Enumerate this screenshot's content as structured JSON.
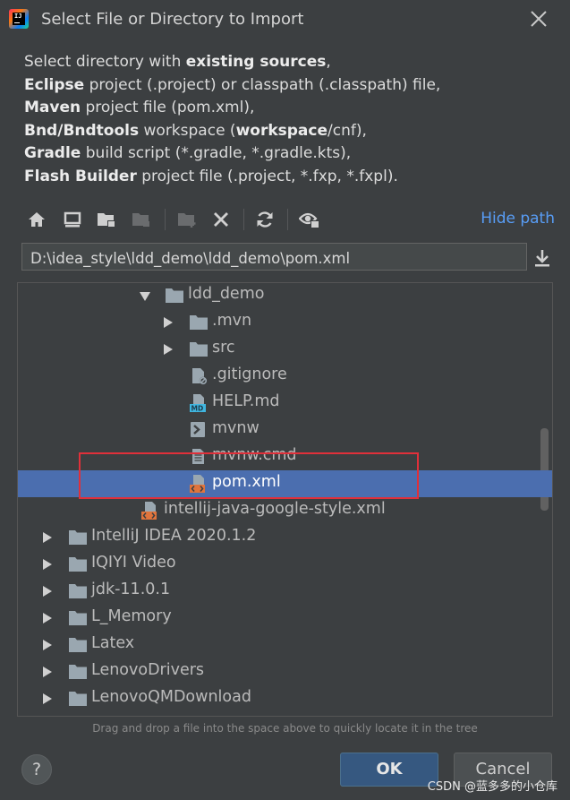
{
  "window": {
    "title": "Select File or Directory to Import",
    "app_icon_text": "IJ"
  },
  "description": {
    "lines": [
      [
        {
          "t": "Select directory with ",
          "b": false
        },
        {
          "t": "existing sources",
          "b": true
        },
        {
          "t": ",",
          "b": false
        }
      ],
      [
        {
          "t": "Eclipse",
          "b": true
        },
        {
          "t": " project (.project) or classpath (.classpath) file,",
          "b": false
        }
      ],
      [
        {
          "t": "Maven",
          "b": true
        },
        {
          "t": " project file (pom.xml),",
          "b": false
        }
      ],
      [
        {
          "t": "Bnd/Bndtools",
          "b": true
        },
        {
          "t": " workspace (",
          "b": false
        },
        {
          "t": "workspace",
          "b": true
        },
        {
          "t": "/cnf),",
          "b": false
        }
      ],
      [
        {
          "t": "Gradle",
          "b": true
        },
        {
          "t": " build script (*.gradle, *.gradle.kts),",
          "b": false
        }
      ],
      [
        {
          "t": "Flash Builder",
          "b": true
        },
        {
          "t": " project file (.project, *.fxp, *.fxpl).",
          "b": false
        }
      ]
    ]
  },
  "toolbar": {
    "hide_path_label": "Hide path",
    "icons": [
      "home-icon",
      "desktop-icon",
      "project-folder-icon",
      "module-folder-icon",
      "new-folder-icon",
      "delete-icon",
      "refresh-icon",
      "show-hidden-icon"
    ]
  },
  "path": {
    "value": "D:\\idea_style\\ldd_demo\\ldd_demo\\pom.xml"
  },
  "tree": {
    "rows": [
      {
        "label": "ldd_demo",
        "icon": "folder",
        "arrow": "down",
        "indent": 5,
        "selected": false
      },
      {
        "label": ".mvn",
        "icon": "folder",
        "arrow": "right",
        "indent": 6,
        "selected": false
      },
      {
        "label": "src",
        "icon": "folder",
        "arrow": "right",
        "indent": 6,
        "selected": false
      },
      {
        "label": ".gitignore",
        "icon": "ignore-file",
        "arrow": "none",
        "indent": 6,
        "selected": false
      },
      {
        "label": "HELP.md",
        "icon": "md-file",
        "arrow": "none",
        "indent": 6,
        "selected": false
      },
      {
        "label": "mvnw",
        "icon": "script-file",
        "arrow": "none",
        "indent": 6,
        "selected": false
      },
      {
        "label": "mvnw.cmd",
        "icon": "text-file",
        "arrow": "none",
        "indent": 6,
        "selected": false
      },
      {
        "label": "pom.xml",
        "icon": "xml-file",
        "arrow": "none",
        "indent": 6,
        "selected": true
      },
      {
        "label": "intellij-java-google-style.xml",
        "icon": "xml-file",
        "arrow": "none",
        "indent": 4,
        "selected": false
      },
      {
        "label": "IntelliJ IDEA 2020.1.2",
        "icon": "folder",
        "arrow": "right",
        "indent": 1,
        "selected": false
      },
      {
        "label": "IQIYI Video",
        "icon": "folder",
        "arrow": "right",
        "indent": 1,
        "selected": false
      },
      {
        "label": "jdk-11.0.1",
        "icon": "folder",
        "arrow": "right",
        "indent": 1,
        "selected": false
      },
      {
        "label": "L_Memory",
        "icon": "folder",
        "arrow": "right",
        "indent": 1,
        "selected": false
      },
      {
        "label": "Latex",
        "icon": "folder",
        "arrow": "right",
        "indent": 1,
        "selected": false
      },
      {
        "label": "LenovoDrivers",
        "icon": "folder",
        "arrow": "right",
        "indent": 1,
        "selected": false
      },
      {
        "label": "LenovoQMDownload",
        "icon": "folder",
        "arrow": "right",
        "indent": 1,
        "selected": false
      }
    ]
  },
  "hint": "Drag and drop a file into the space above to quickly locate it in the tree",
  "buttons": {
    "help": "?",
    "ok": "OK",
    "cancel": "Cancel"
  },
  "watermark": "CSDN @蓝多多的小仓库",
  "colors": {
    "background": "#3c3f41",
    "selection": "#4b6eaf",
    "link": "#589df6",
    "highlight_box": "#e0303a",
    "ok_button": "#365880"
  }
}
